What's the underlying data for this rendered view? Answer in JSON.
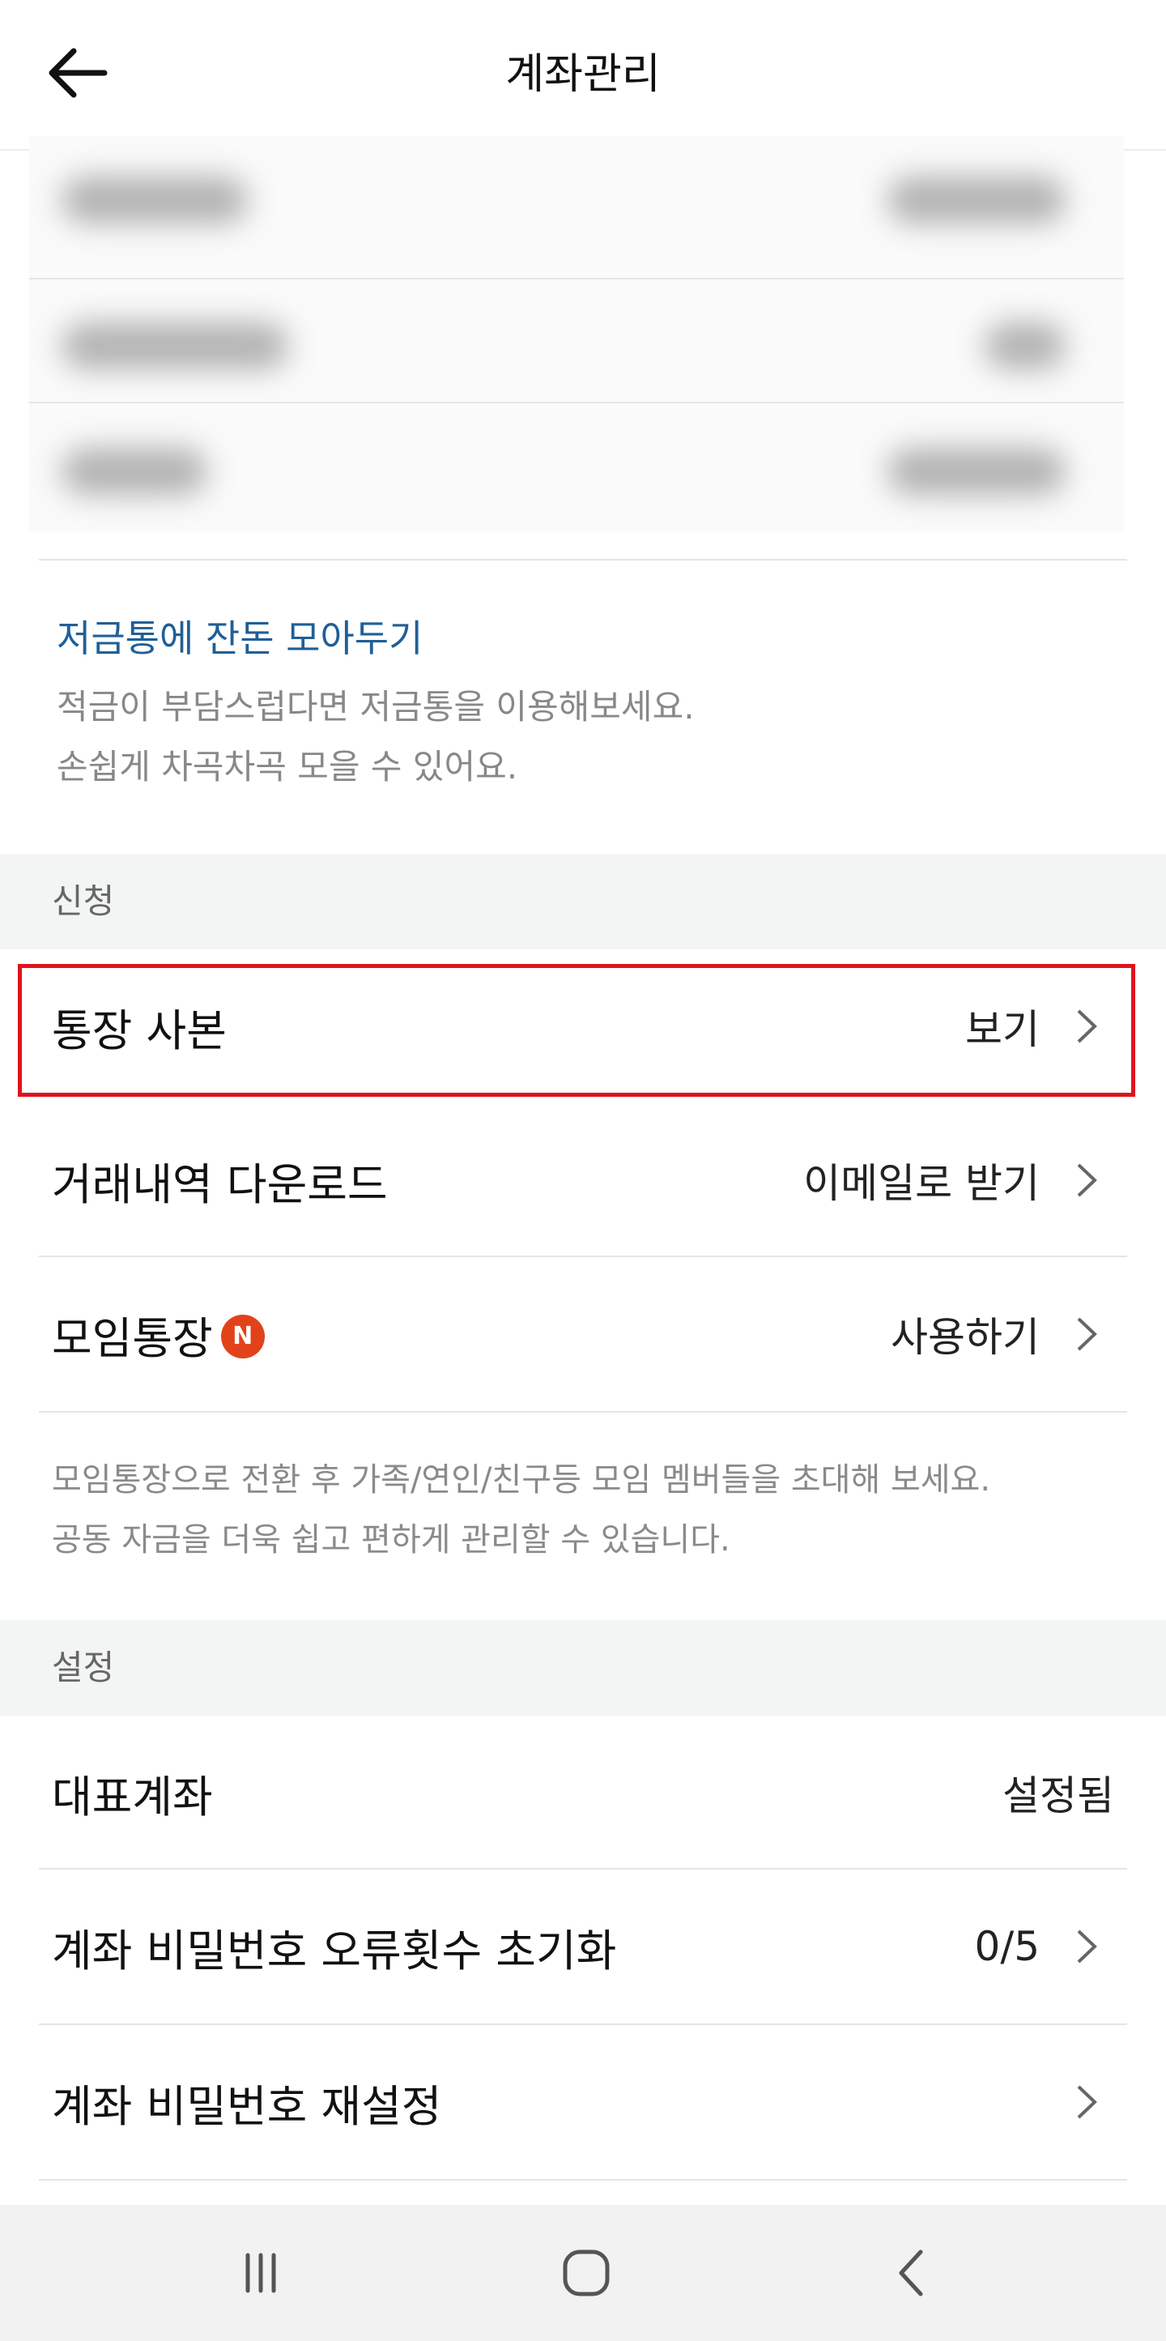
{
  "header": {
    "title": "계좌관리",
    "back_icon": "arrow-left-icon"
  },
  "promo": {
    "title": "저금통에 잔돈 모아두기",
    "line1": "적금이 부담스럽다면 저금통을 이용해보세요.",
    "line2": "손쉽게 차곡차곡 모을 수 있어요."
  },
  "sections": {
    "apply": "신청",
    "settings": "설정"
  },
  "rows": {
    "bankbook": {
      "label": "통장 사본",
      "value": "보기"
    },
    "download": {
      "label": "거래내역 다운로드",
      "value": "이메일로 받기"
    },
    "group": {
      "label": "모임통장",
      "badge": "N",
      "value": "사용하기"
    },
    "primary": {
      "label": "대표계좌",
      "value": "설정됨"
    },
    "pw_reset_count": {
      "label": "계좌 비밀번호 오류횟수 초기화",
      "value": "0/5"
    },
    "pw_reset": {
      "label": "계좌 비밀번호 재설정"
    }
  },
  "group_note": {
    "line1": "모임통장으로 전환 후 가족/연인/친구등 모임 멤버들을 초대해 보세요.",
    "line2": "공동 자금을 더욱 쉽고 편하게 관리할 수 있습니다."
  },
  "colors": {
    "link_blue": "#1f5f98",
    "badge_orange": "#e2421a",
    "highlight_red": "#e0141c",
    "section_bg": "#f3f4f4"
  },
  "nav": {
    "recent_icon": "recent-apps-icon",
    "home_icon": "home-icon",
    "back_icon": "back-chevron-icon"
  }
}
